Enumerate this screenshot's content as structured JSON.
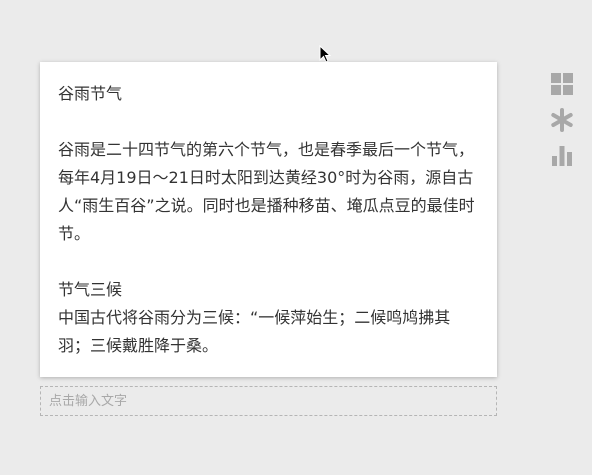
{
  "card": {
    "title": "谷雨节气",
    "paragraph1": "谷雨是二十四节气的第六个节气，也是春季最后一个节气，每年4月19日～21日时太阳到达黄经30°时为谷雨，源自古人“雨生百谷”之说。同时也是播种移苗、埯瓜点豆的最佳时节。",
    "subtitle": "节气三候",
    "paragraph2": "中国古代将谷雨分为三候：“一候萍始生；二候鸣鸠拂其羽；三候戴胜降于桑。"
  },
  "input": {
    "placeholder": "点击输入文字",
    "value": ""
  },
  "tools": [
    {
      "icon": "grid-icon"
    },
    {
      "icon": "asterisk-icon"
    },
    {
      "icon": "bar-chart-icon"
    }
  ],
  "colors": {
    "background": "#ebebeb",
    "card": "#ffffff",
    "text": "#333333",
    "icon": "#a8a8a8"
  }
}
